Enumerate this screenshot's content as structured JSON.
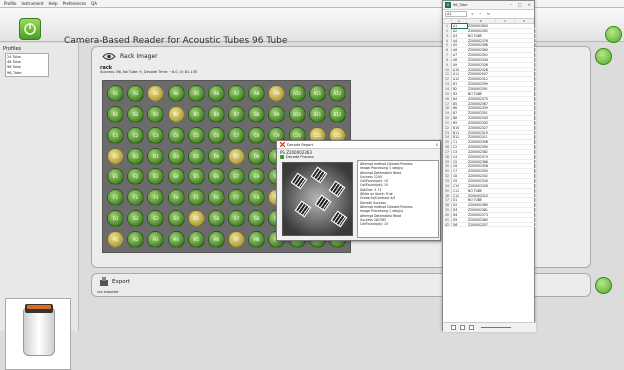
{
  "menubar": {
    "items": [
      "Profile",
      "Instrument",
      "Help",
      "Preferences",
      "QA"
    ]
  },
  "header": {
    "title": "Camera-Based Reader for Acoustic Tubes   96 Tube"
  },
  "profiles": {
    "title": "Profiles",
    "items": [
      "24 Tube",
      "48 Tube",
      "96 Tube",
      "96_Tube"
    ]
  },
  "imager": {
    "title": "Rack Imager",
    "rack_name": "rack",
    "status": "Success: 86, No Tube: 9, Decode Time: ~8.0, Q: 81.135"
  },
  "plate": {
    "rows": [
      "A",
      "B",
      "C",
      "D",
      "E",
      "F",
      "G",
      "H"
    ],
    "cols": [
      "1",
      "2",
      "3",
      "4",
      "5",
      "6",
      "7",
      "8",
      "9",
      "10",
      "11",
      "12"
    ],
    "no_tube_wells": [
      "A3",
      "A9",
      "B4",
      "C11",
      "C12",
      "D1",
      "D7",
      "F9",
      "G5",
      "H1",
      "H7"
    ]
  },
  "decode_dialog": {
    "title": "Decode Report",
    "barcode": "PS Z200002363",
    "process_label": "Decode Process",
    "close": "x",
    "log": [
      "Attempt method Decode Process",
      "Image Processing 1 step(s)",
      "Attempt Datamatrix Read",
      "Success 2200",
      "CellFound(ok): 10",
      "CellFound(ok): 10",
      "DotSize: 2.71",
      "White on black: True",
      "Grade:Sz/Contrast 4/4",
      "Decode Success",
      "Attempt method Decode Process",
      "Image Processing 1 step(s)",
      "Attempt Datamatrix Read",
      "Success 282363",
      "CellFound(ok): 15"
    ]
  },
  "export": {
    "title": "Export",
    "subtitle": "csv exporter"
  },
  "excel": {
    "title": "96_Tube",
    "name_box": "A1",
    "formula_icons": [
      "×",
      "✓",
      "fx"
    ],
    "window_controls": [
      "–",
      "□",
      "×"
    ],
    "columns": [
      "A",
      "B",
      "C",
      "D"
    ],
    "rows": [
      [
        "1",
        "A1",
        "Z200001600"
      ],
      [
        "2",
        "A2",
        "Z200002392"
      ],
      [
        "3",
        "A3",
        "NO TUBE"
      ],
      [
        "4",
        "A4",
        "Z200002376"
      ],
      [
        "5",
        "A5",
        "Z200002368"
      ],
      [
        "6",
        "A6",
        "Z200002360"
      ],
      [
        "7",
        "A7",
        "Z200002352"
      ],
      [
        "8",
        "A8",
        "Z200002344"
      ],
      [
        "9",
        "A9",
        "Z200002336"
      ],
      [
        "10",
        "A10",
        "Z200002328"
      ],
      [
        "11",
        "A11",
        "Z200002007"
      ],
      [
        "12",
        "A12",
        "Z200002312"
      ],
      [
        "13",
        "B1",
        "Z200002399"
      ],
      [
        "14",
        "B2",
        "Z200002391"
      ],
      [
        "15",
        "B3",
        "NO TUBE"
      ],
      [
        "16",
        "B4",
        "Z200002375"
      ],
      [
        "17",
        "B5",
        "Z200002367"
      ],
      [
        "18",
        "B6",
        "Z200002359"
      ],
      [
        "19",
        "B7",
        "Z200002351"
      ],
      [
        "20",
        "B8",
        "Z200002343"
      ],
      [
        "21",
        "B9",
        "Z200002335"
      ],
      [
        "22",
        "B10",
        "Z200002327"
      ],
      [
        "23",
        "B11",
        "Z200002319"
      ],
      [
        "24",
        "B12",
        "Z200002311"
      ],
      [
        "25",
        "C1",
        "Z200002398"
      ],
      [
        "26",
        "C2",
        "Z200002390"
      ],
      [
        "27",
        "C3",
        "Z200002382"
      ],
      [
        "28",
        "C4",
        "Z200002374"
      ],
      [
        "29",
        "C5",
        "Z200002366"
      ],
      [
        "30",
        "C6",
        "Z200002358"
      ],
      [
        "31",
        "C7",
        "Z200002350"
      ],
      [
        "32",
        "C8",
        "Z200002342"
      ],
      [
        "33",
        "C9",
        "Z200002334"
      ],
      [
        "34",
        "C10",
        "Z200002326"
      ],
      [
        "35",
        "C11",
        "NO TUBE"
      ],
      [
        "36",
        "C12",
        "Z200002310"
      ],
      [
        "37",
        "D1",
        "NO TUBE"
      ],
      [
        "38",
        "D2",
        "Z200002389"
      ],
      [
        "39",
        "D3",
        "Z200002381"
      ],
      [
        "40",
        "D4",
        "Z200002373"
      ],
      [
        "41",
        "D5",
        "Z200002365"
      ],
      [
        "42",
        "D6",
        "Z200002357"
      ]
    ]
  }
}
